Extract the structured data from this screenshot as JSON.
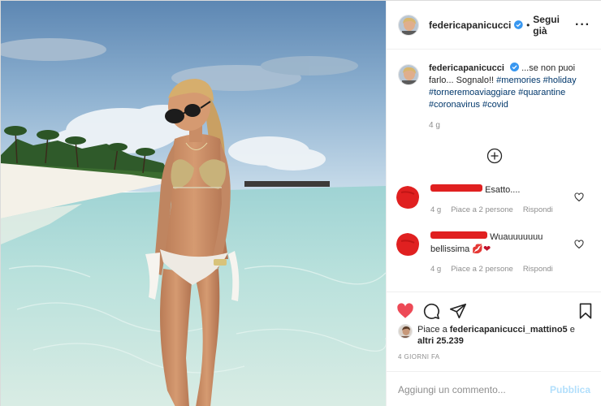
{
  "post": {
    "username": "federicapanicucci",
    "follow_label": "Segui già",
    "more_label": "···"
  },
  "caption": {
    "username": "federicapanicucci",
    "text": "...se non puoi farlo... Sognalo!!",
    "hashtags": [
      "#memories",
      "#holiday",
      "#torneremoaviaggiare",
      "#quarantine",
      "#coronavirus",
      "#covid"
    ],
    "time": "4 g"
  },
  "comments": [
    {
      "text": "Esatto....",
      "time": "4 g",
      "likes": "Piace a 2 persone",
      "reply": "Rispondi"
    },
    {
      "text": "Wuauuuuuuu bellissima",
      "emoji": "💋❤",
      "time": "4 g",
      "likes": "Piace a 2 persone",
      "reply": "Rispondi"
    }
  ],
  "likes": {
    "prefix": "Piace a",
    "user": "federicapanicucci_mattino5",
    "middle": "e",
    "others": "altri 25.239"
  },
  "posted_ago": "4 GIORNI FA",
  "add_comment": {
    "placeholder": "Aggiungi un commento...",
    "publish_label": "Pubblica"
  },
  "colors": {
    "heart": "#ed4956",
    "verified": "#3897f0",
    "hashtag": "#00376b",
    "publish_disabled": "#b2dffc",
    "redaction": "#e02020"
  }
}
